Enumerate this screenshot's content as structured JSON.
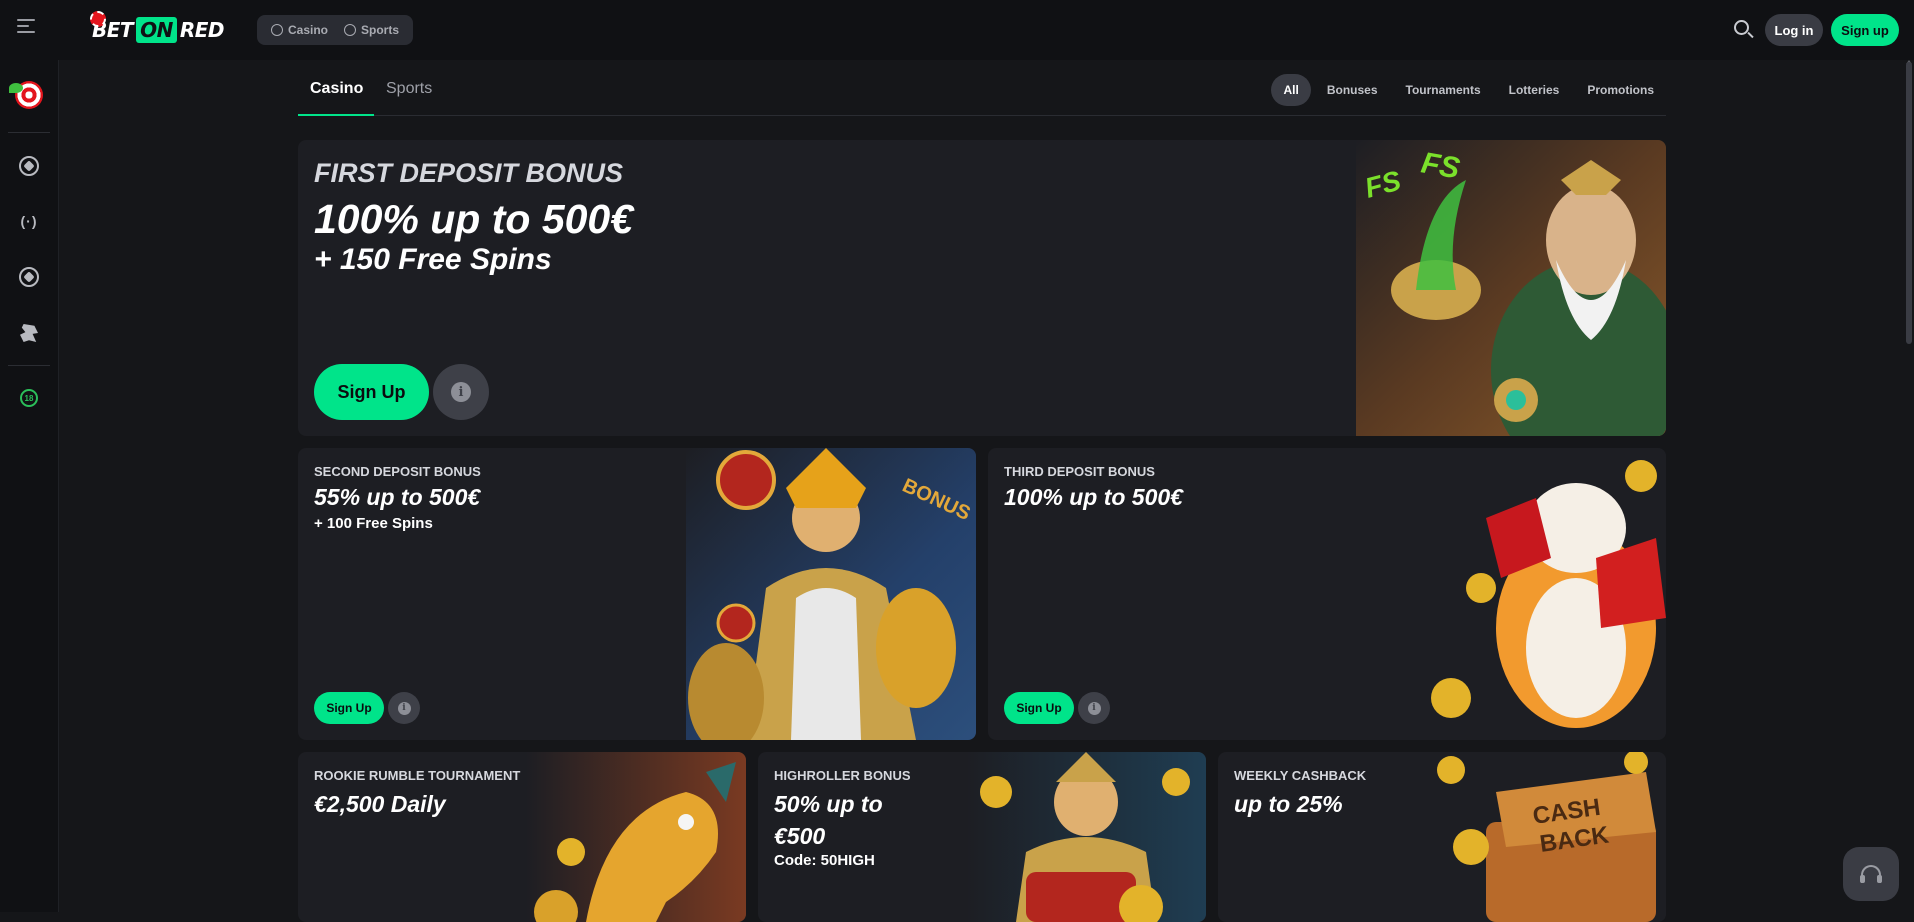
{
  "header": {
    "brand_left": "BET",
    "brand_mid": "ON",
    "brand_right": "RED",
    "modes": [
      "Casino",
      "Sports"
    ],
    "login_label": "Log in",
    "signup_label": "Sign up"
  },
  "tabs": {
    "casino": "Casino",
    "sports": "Sports"
  },
  "filters": [
    "All",
    "Bonuses",
    "Tournaments",
    "Lotteries",
    "Promotions"
  ],
  "filter_active": "All",
  "hero": {
    "title": "FIRST DEPOSIT BONUS",
    "line1": "100% up to 500€",
    "line2": "+ 150 Free Spins",
    "cta": "Sign Up"
  },
  "cards": {
    "second": {
      "title": "SECOND DEPOSIT BONUS",
      "headline": "55% up to 500€",
      "sub": "+ 100 Free Spins",
      "cta": "Sign Up"
    },
    "third": {
      "title": "THIRD DEPOSIT BONUS",
      "headline": "100% up to 500€",
      "cta": "Sign Up"
    },
    "rookie": {
      "title": "ROOKIE RUMBLE TOURNAMENT",
      "headline": "€2,500 Daily"
    },
    "highroller": {
      "title": "HIGHROLLER BONUS",
      "headline": "50% up to €500",
      "code": "Code: 50HIGH"
    },
    "weekly": {
      "title": "WEEKLY CASHBACK",
      "headline": "up to 25%"
    }
  },
  "art_text": {
    "fs": "FS",
    "bonus": "BONUS",
    "cash": "CASH",
    "back": "BACK",
    "chip_18": "18"
  },
  "colors": {
    "accent": "#00e48a",
    "brand_red": "#e3151d",
    "background": "#151619",
    "card": "#1d1e23"
  },
  "icons": {
    "menu": "menu-icon",
    "search": "search-icon",
    "info": "info-icon",
    "support": "headset-icon"
  }
}
